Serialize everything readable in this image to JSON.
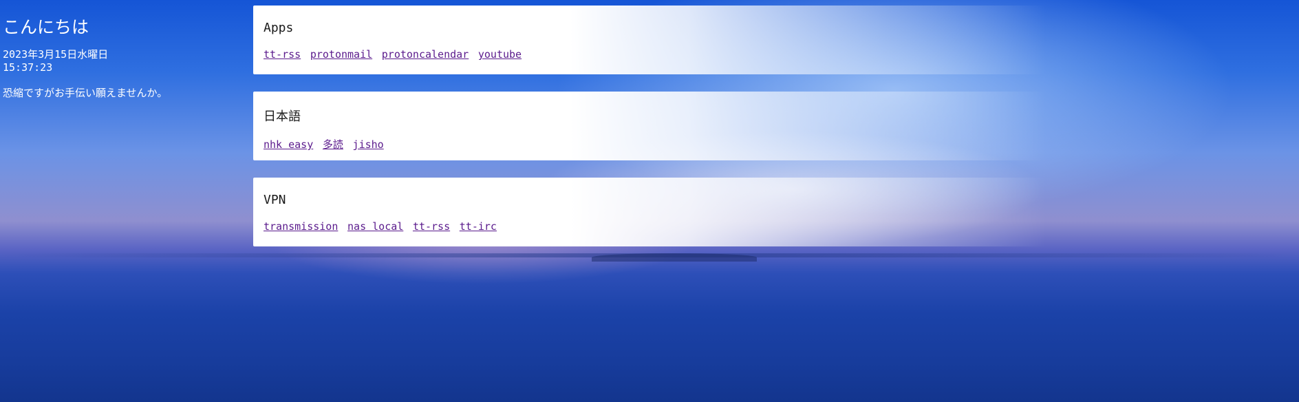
{
  "sidebar": {
    "greeting": "こんにちは",
    "date": "2023年3月15日水曜日",
    "time": "15:37:23",
    "message": "恐縮ですがお手伝い願えませんか。"
  },
  "cards": [
    {
      "title": "Apps",
      "links": [
        "tt-rss",
        "protonmail",
        "protoncalendar",
        "youtube"
      ]
    },
    {
      "title": "日本語",
      "links": [
        "nhk easy",
        "多読",
        "jisho"
      ]
    },
    {
      "title": "VPN",
      "links": [
        "transmission",
        "nas local",
        "tt-rss",
        "tt-irc"
      ]
    }
  ],
  "colors": {
    "link": "#5a1a8c",
    "card_bg": "#ffffff",
    "sky_top": "#1555d6",
    "sea": "#173c9c"
  }
}
